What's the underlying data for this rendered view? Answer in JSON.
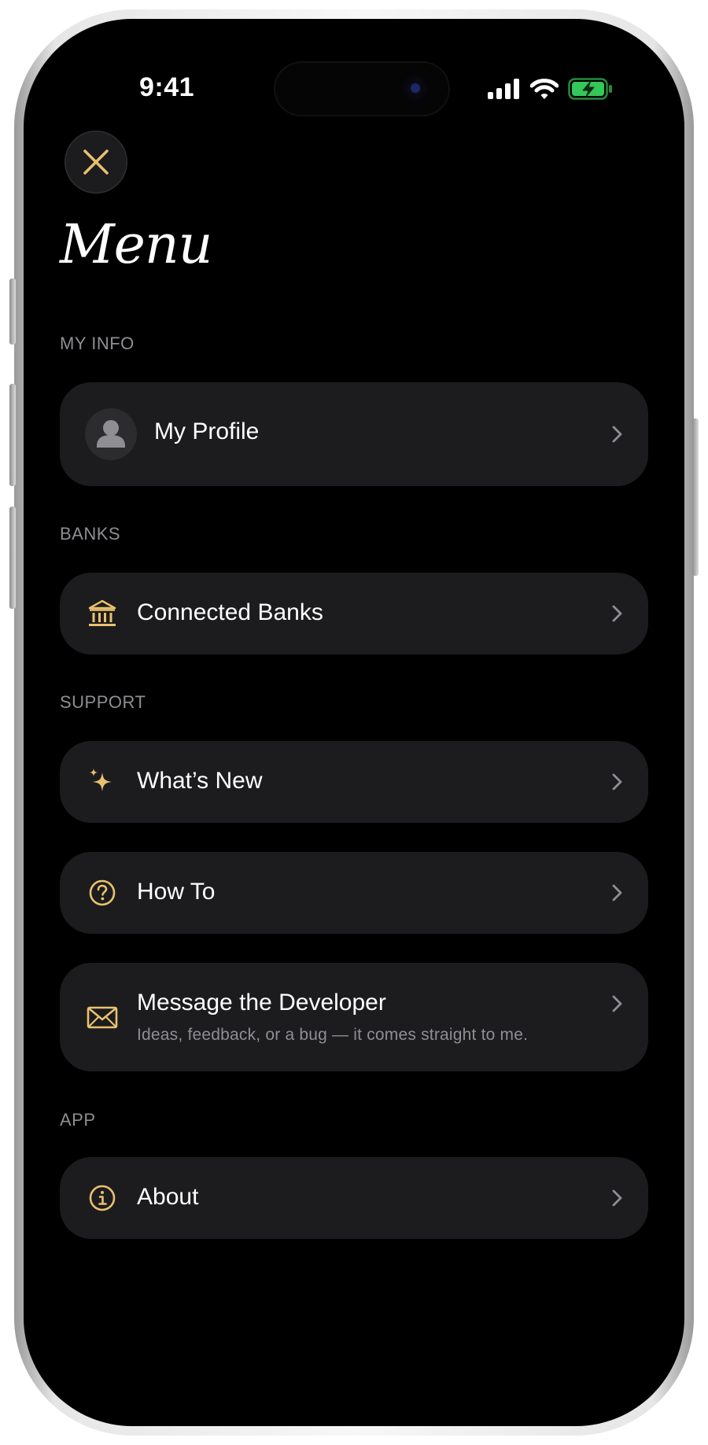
{
  "status_bar": {
    "time": "9:41"
  },
  "header": {
    "close_icon": "xmark-icon",
    "title": "Menu"
  },
  "colors": {
    "background": "#000000",
    "card": "#1c1c1e",
    "accent_gold": "#e8c16f",
    "section_label": "#8e8e93",
    "battery_green": "#34c759"
  },
  "sections": {
    "my_info": {
      "label": "MY INFO",
      "items": [
        {
          "label": "My Profile",
          "icon": "person-avatar-icon"
        }
      ]
    },
    "banks": {
      "label": "BANKS",
      "items": [
        {
          "label": "Connected Banks",
          "icon": "bank-building-icon"
        }
      ]
    },
    "support": {
      "label": "SUPPORT",
      "items": [
        {
          "label": "What’s New",
          "icon": "sparkles-icon"
        },
        {
          "label": "How To",
          "icon": "question-circle-icon"
        },
        {
          "label": "Message the Developer",
          "subtitle": "Ideas, feedback, or a bug — it comes straight to me.",
          "icon": "envelope-icon"
        }
      ]
    },
    "app": {
      "label": "APP",
      "items": [
        {
          "label": "About",
          "icon": "info-circle-icon"
        }
      ]
    }
  }
}
